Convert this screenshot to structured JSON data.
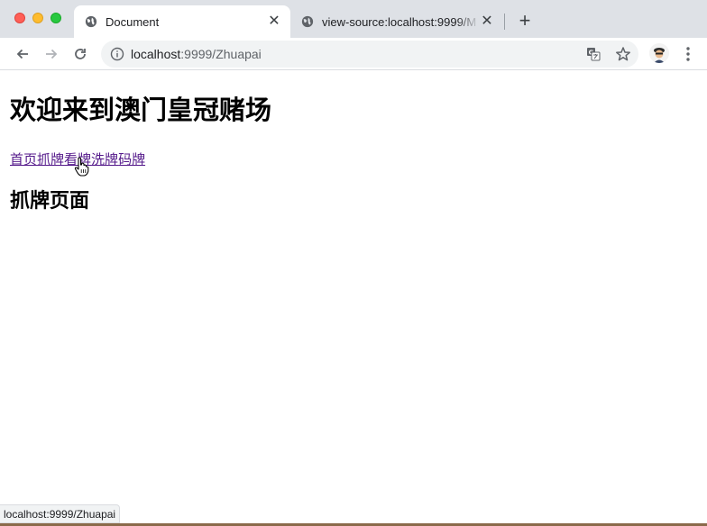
{
  "tabs": [
    {
      "title": "Document",
      "icon": "globe-icon",
      "active": true
    },
    {
      "title": "view-source:localhost:9999/M",
      "icon": "globe-icon",
      "active": false
    }
  ],
  "toolbar": {
    "url_host": "localhost",
    "url_path": ":9999/Zhuapai"
  },
  "page": {
    "heading": "欢迎来到澳门皇冠赌场",
    "links": [
      "首页",
      "抓牌",
      "看牌",
      "洗牌",
      "码牌"
    ],
    "subheading": "抓牌页面"
  },
  "status_url": "localhost:9999/Zhuapai",
  "colors": {
    "tabstrip": "#dee1e6",
    "link_visited": "#551a8b",
    "traffic_close": "#ff5f57",
    "traffic_min": "#febc2e",
    "traffic_max": "#28c840"
  }
}
